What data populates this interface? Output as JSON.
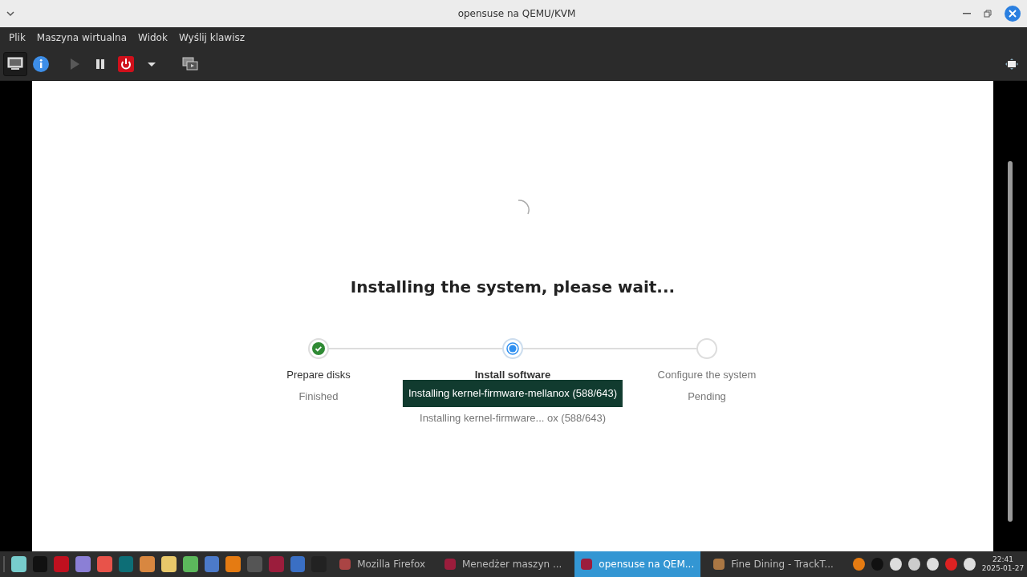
{
  "window": {
    "title": "opensuse na QEMU/KVM"
  },
  "menu": [
    "Plik",
    "Maszyna wirtualna",
    "Widok",
    "Wyślij klawisz"
  ],
  "toolbar": [
    {
      "kind": "console",
      "selected": true
    },
    {
      "kind": "info",
      "selected": false
    },
    {
      "kind": "run",
      "disabled": true
    },
    {
      "kind": "pause",
      "disabled": false
    },
    {
      "kind": "power",
      "disabled": false
    },
    {
      "kind": "dropdown",
      "disabled": false
    },
    {
      "kind": "snapshots",
      "disabled": false
    }
  ],
  "installer": {
    "heading": "Installing the system, please wait...",
    "steps": [
      {
        "label": "Prepare disks",
        "status": "Finished",
        "kind": "done"
      },
      {
        "label": "Install software",
        "kind": "active"
      },
      {
        "label": "Configure the system",
        "status": "Pending",
        "kind": "pending"
      }
    ],
    "tooltip": "Installing kernel-firmware-mellanox (588/643)",
    "progress_text": "Installing kernel-firmware... ox (588/643)"
  },
  "taskbar": {
    "windows": [
      {
        "label": "Mozilla Firefox",
        "selected": false
      },
      {
        "label": "Menedżer maszyn ...",
        "selected": false
      },
      {
        "label": "opensuse na QEM...",
        "selected": true
      },
      {
        "label": "Fine Dining - TrackT...",
        "selected": false
      }
    ],
    "time": "22:41",
    "date": "2025-01-27"
  }
}
